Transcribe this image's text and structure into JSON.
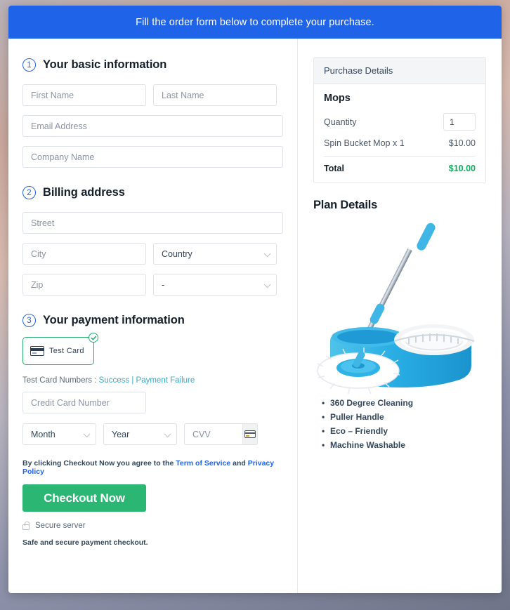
{
  "banner": {
    "text": "Fill the order form below to complete your purchase."
  },
  "sections": {
    "basic": {
      "number": "1",
      "title": "Your basic information"
    },
    "billing": {
      "number": "2",
      "title": "Billing address"
    },
    "payment": {
      "number": "3",
      "title": "Your payment information"
    }
  },
  "fields": {
    "first_name": {
      "placeholder": "First Name",
      "value": ""
    },
    "last_name": {
      "placeholder": "Last Name",
      "value": ""
    },
    "email": {
      "placeholder": "Email Address",
      "value": ""
    },
    "company": {
      "placeholder": "Company Name",
      "value": ""
    },
    "street": {
      "placeholder": "Street",
      "value": ""
    },
    "city": {
      "placeholder": "City",
      "value": ""
    },
    "country": {
      "selected": "Country"
    },
    "zip": {
      "placeholder": "Zip",
      "value": ""
    },
    "state": {
      "selected": "-"
    },
    "credit_card": {
      "placeholder": "Credit Card Number",
      "value": ""
    },
    "month": {
      "selected": "Month"
    },
    "year": {
      "selected": "Year"
    },
    "cvv": {
      "placeholder": "CVV",
      "value": ""
    }
  },
  "payment": {
    "card_tile_label": "Test  Card",
    "card_tile_icon": "credit-card-icon",
    "selected_badge_icon": "check-circle-icon",
    "test_numbers_label": "Test Card Numbers :",
    "success_link": "Success",
    "separator": "|",
    "failure_link": "Payment Failure",
    "cvv_icon": "credit-card-icon"
  },
  "footer": {
    "terms_prefix": "By clicking Checkout Now you agree to the",
    "terms_link": "Term of Service",
    "terms_and": "and",
    "privacy_link": "Privacy Policy",
    "checkout_label": "Checkout Now",
    "secure_icon": "lock-icon",
    "secure_label": "Secure server",
    "safe_note": "Safe and secure payment checkout."
  },
  "purchase": {
    "header": "Purchase Details",
    "product": "Mops",
    "quantity_label": "Quantity",
    "quantity_value": "1",
    "item_label": "Spin Bucket Mop x 1",
    "item_price": "$10.00",
    "total_label": "Total",
    "total_price": "$10.00"
  },
  "plan": {
    "title": "Plan Details",
    "image_alt": "spin-bucket-mop-product-image",
    "features": [
      "360 Degree Cleaning",
      "Puller Handle",
      "Eco – Friendly",
      "Machine Washable"
    ]
  },
  "colors": {
    "banner_blue": "#1f64e8",
    "accent_blue": "#1f64e8",
    "checkout_green": "#2bb673",
    "total_green": "#0fae62",
    "card_selected_green": "#25ad6d",
    "link_teal": "#37abc8"
  }
}
